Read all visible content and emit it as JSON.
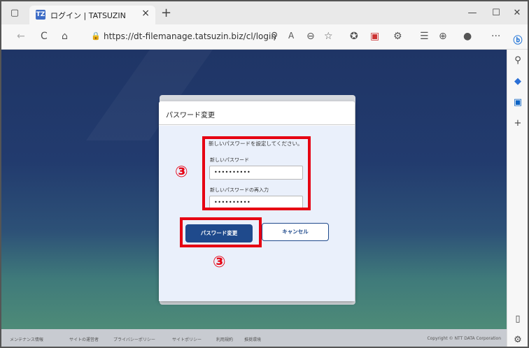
{
  "browser": {
    "tab_title": "ログイン | TATSUZIN",
    "tab_favicon": "TZ",
    "url": "https://dt-filemanage.tatsuzin.biz/cl/login",
    "new_tab": "+",
    "close_tab": "×",
    "minimize": "—",
    "maximize": "☐",
    "close": "✕",
    "back": "←",
    "refresh": "C",
    "home": "⌂",
    "lock": "🔒",
    "more": "···"
  },
  "sidebar": {
    "icons": [
      "bing-icon",
      "search-icon",
      "shopping-icon",
      "outlook-icon",
      "add-icon",
      "panel-icon",
      "settings-icon"
    ]
  },
  "dialog": {
    "title": "パスワード変更",
    "instruction": "新しいパスワードを設定してください。",
    "new_password_label": "新しいパスワード",
    "new_password_value": "••••••••••",
    "confirm_password_label": "新しいパスワードの再入力",
    "confirm_password_value": "••••••••••",
    "submit_label": "パスワード変更",
    "cancel_label": "キャンセル"
  },
  "annotations": {
    "step_marker_1": "③",
    "step_marker_2": "③",
    "highlight_color": "#e60012"
  },
  "footer": {
    "links": [
      "メンテナンス情報",
      "サイトの運営者",
      "プライバシーポリシー",
      "サイトポリシー",
      "利用規約",
      "推奨環境"
    ],
    "copyright": "Copyright © NTT DATA Corporation"
  }
}
